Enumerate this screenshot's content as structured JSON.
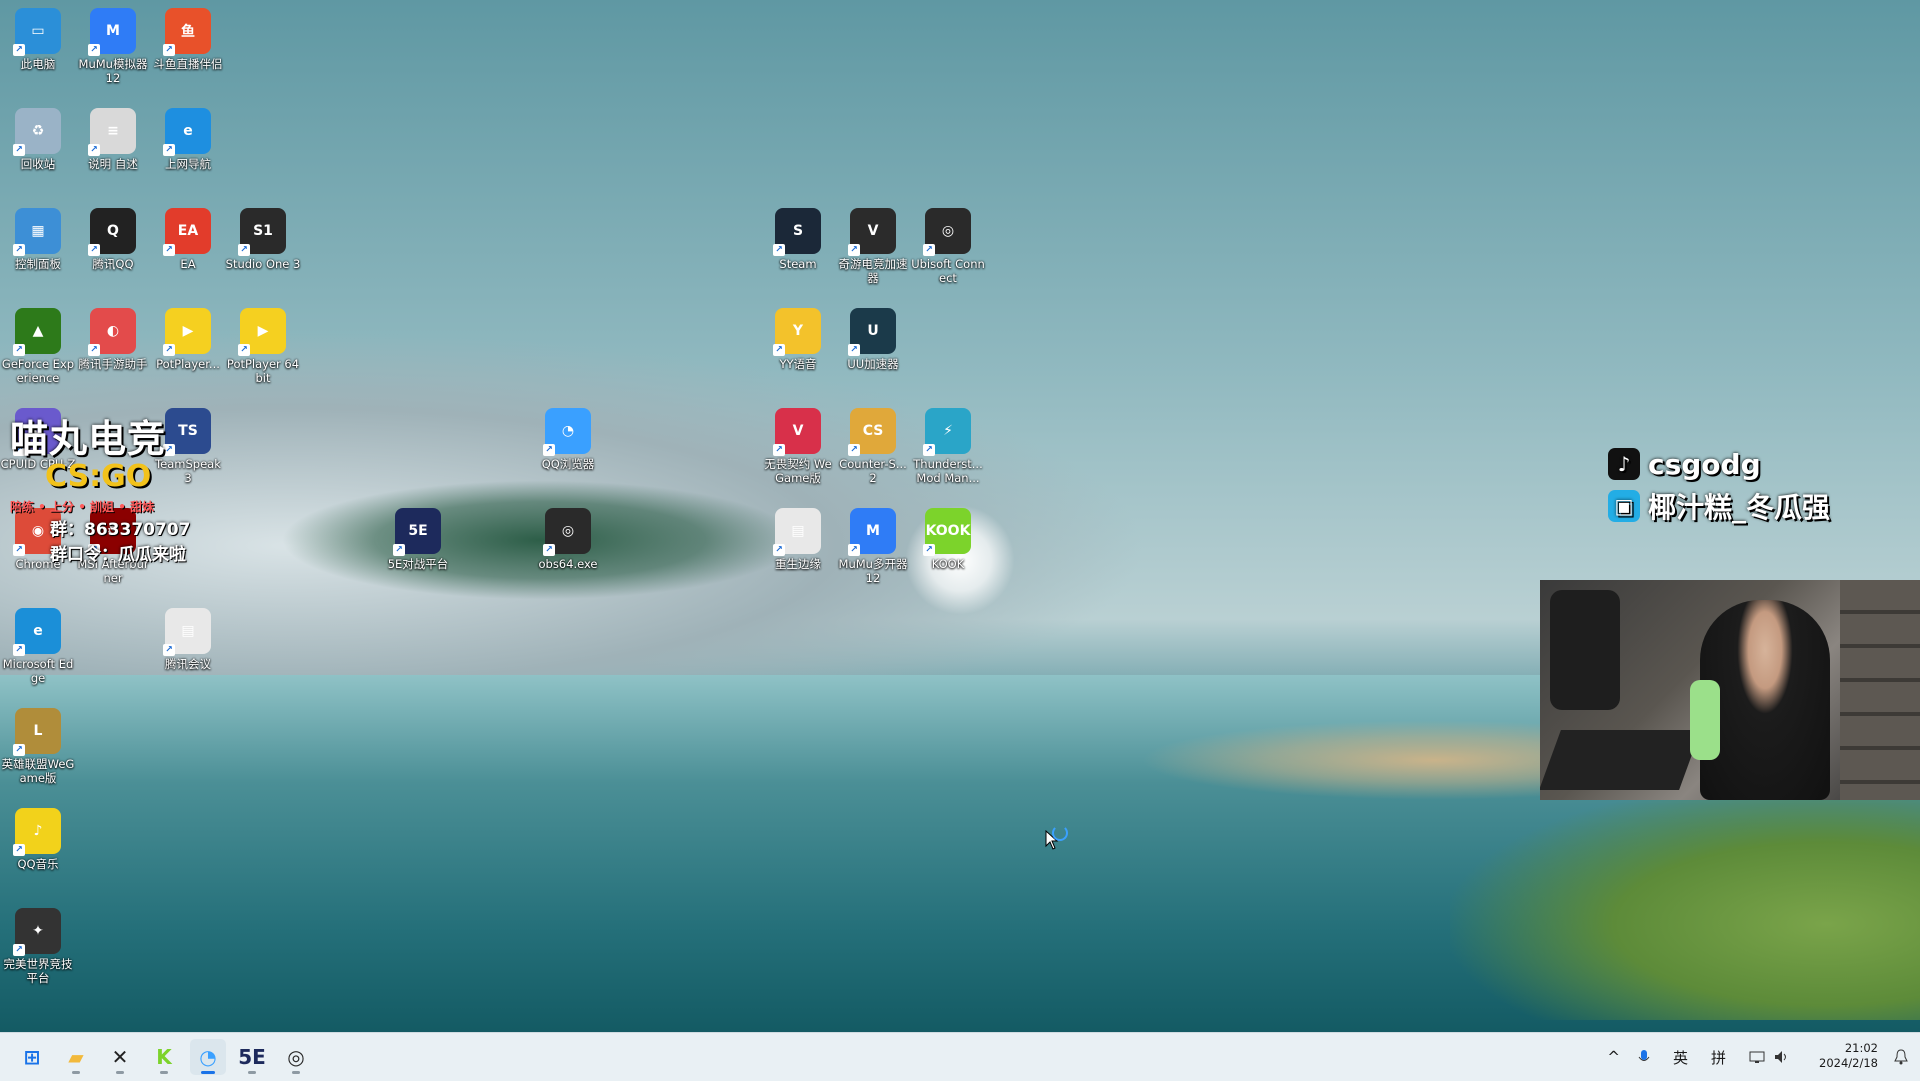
{
  "desktop_icons": [
    {
      "label": "此电脑",
      "glyph": "▭",
      "color": "#2b8fd8"
    },
    {
      "label": "MuMu模拟器12",
      "glyph": "M",
      "color": "#2f7cf6"
    },
    {
      "label": "斗鱼直播伴侣",
      "glyph": "鱼",
      "color": "#e8512a"
    },
    {
      "label": "回收站",
      "glyph": "♻",
      "color": "#9ab3c7"
    },
    {
      "label": "说明 自述",
      "glyph": "≡",
      "color": "#d9d9d9"
    },
    {
      "label": "上网导航",
      "glyph": "e",
      "color": "#1e8fe0"
    },
    {
      "label": "控制面板",
      "glyph": "▦",
      "color": "#3d8fd6"
    },
    {
      "label": "腾讯QQ",
      "glyph": "Q",
      "color": "#222222"
    },
    {
      "label": "EA",
      "glyph": "EA",
      "color": "#e23c2b"
    },
    {
      "label": "Studio One 3",
      "glyph": "S1",
      "color": "#2a2a2a"
    },
    {
      "label": "GeForce Experience",
      "glyph": "▲",
      "color": "#2d7a1a"
    },
    {
      "label": "腾讯手游助手",
      "glyph": "◐",
      "color": "#e34b4b"
    },
    {
      "label": "PotPlayer...",
      "glyph": "▶",
      "color": "#f5d020"
    },
    {
      "label": "PotPlayer 64 bit",
      "glyph": "▶",
      "color": "#f5d020"
    },
    {
      "label": "CPUID CPU-Z",
      "glyph": "C",
      "color": "#6a5acd"
    },
    {
      "label": "TeamSpeak 3",
      "glyph": "TS",
      "color": "#2c4b8f"
    },
    {
      "label": "Chrome",
      "glyph": "◉",
      "color": "#dd4b39"
    },
    {
      "label": "MSI Afterburner",
      "glyph": "⚙",
      "color": "#8b0000"
    },
    {
      "label": "Microsoft Edge",
      "glyph": "e",
      "color": "#1b8fd8"
    },
    {
      "label": "腾讯会议",
      "glyph": "▤",
      "color": "#e8e8e8"
    },
    {
      "label": "英雄联盟WeGame版",
      "glyph": "L",
      "color": "#b08d3a"
    },
    {
      "label": "QQ音乐",
      "glyph": "♪",
      "color": "#f2d21b"
    },
    {
      "label": "完美世界竞技平台",
      "glyph": "✦",
      "color": "#333333"
    },
    {
      "label": "QQ浏览器",
      "glyph": "◔",
      "color": "#3aa0ff"
    },
    {
      "label": "5E对战平台",
      "glyph": "5E",
      "color": "#1d2a5c"
    },
    {
      "label": "obs64.exe",
      "glyph": "◎",
      "color": "#2a2a2a"
    },
    {
      "label": "Steam",
      "glyph": "S",
      "color": "#1b2838"
    },
    {
      "label": "奇游电竞加速器",
      "glyph": "V",
      "color": "#2b2b2b"
    },
    {
      "label": "Ubisoft Connect",
      "glyph": "◎",
      "color": "#2a2a2a"
    },
    {
      "label": "YY语音",
      "glyph": "Y",
      "color": "#f3c22b"
    },
    {
      "label": "UU加速器",
      "glyph": "U",
      "color": "#1b3a4a"
    },
    {
      "label": "无畏契约 WeGame版",
      "glyph": "V",
      "color": "#d8304a"
    },
    {
      "label": "Counter-S... 2",
      "glyph": "CS",
      "color": "#e0a83a"
    },
    {
      "label": "Thunderst... Mod Man...",
      "glyph": "⚡",
      "color": "#2aa5c8"
    },
    {
      "label": "重生边缘",
      "glyph": "▤",
      "color": "#e8e8e8"
    },
    {
      "label": "MuMu多开器12",
      "glyph": "M",
      "color": "#2f7cf6"
    },
    {
      "label": "KOOK",
      "glyph": "KOOK",
      "color": "#7cd32b"
    }
  ],
  "brand": {
    "title": "喵丸电竞",
    "game": "CS:GO",
    "tags": "陪练 • 上分 • 訓姐 • 甜妹",
    "group": "群：863370707",
    "code": "群口令：瓜瓜来啦"
  },
  "social": {
    "douyin": "csgodg",
    "bilibili": "椰汁糕_冬瓜强"
  },
  "taskbar": {
    "apps": [
      {
        "name": "start",
        "glyph": "⊞",
        "color": "#1a73e8"
      },
      {
        "name": "file-explorer",
        "glyph": "▰",
        "color": "#f2b93b"
      },
      {
        "name": "studio-one",
        "glyph": "✕",
        "color": "#222222"
      },
      {
        "name": "kook",
        "glyph": "K",
        "color": "#7cd32b"
      },
      {
        "name": "qq-browser",
        "glyph": "◔",
        "color": "#3aa0ff"
      },
      {
        "name": "5e-platform",
        "glyph": "5E",
        "color": "#1d2a5c"
      },
      {
        "name": "obs",
        "glyph": "◎",
        "color": "#2a2a2a"
      }
    ],
    "tray": {
      "chevron": "^",
      "lang": "英",
      "ime": "拼",
      "time": "21:02",
      "date": "2024/2/18"
    }
  }
}
